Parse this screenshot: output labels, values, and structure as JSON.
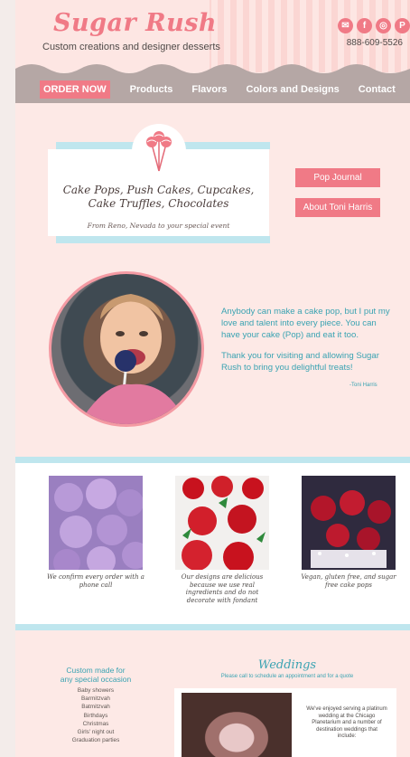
{
  "brand": {
    "name": "Sugar Rush",
    "tagline": "Custom creations and designer desserts",
    "phone": "888-609-5526"
  },
  "social": [
    {
      "icon": "email-icon",
      "glyph": "✉"
    },
    {
      "icon": "facebook-icon",
      "glyph": "f"
    },
    {
      "icon": "instagram-icon",
      "glyph": "◎"
    },
    {
      "icon": "pinterest-icon",
      "glyph": "P"
    }
  ],
  "nav": {
    "order": "ORDER NOW",
    "items": [
      "Products",
      "Flavors",
      "Colors and Designs",
      "Contact"
    ]
  },
  "hero": {
    "title_line1": "Cake Pops, Push Cakes, Cupcakes,",
    "title_line2": "Cake Truffles, Chocolates",
    "subtitle": "From Reno, Nevada to your special event"
  },
  "side_buttons": [
    "Pop Journal",
    "About Toni Harris"
  ],
  "intro": {
    "p1": "Anybody can make a cake pop, but I put my love and talent into every piece. You can have your cake (Pop) and eat it too.",
    "p2": "Thank you for visiting and allowing Sugar Rush to bring you delightful treats!",
    "signature": "-Toni Harris"
  },
  "gallery": [
    {
      "caption": "We confirm every order with a phone call"
    },
    {
      "caption": "Our designs are delicious because we use real ingredients and do not decorate with fondant"
    },
    {
      "caption": "Vegan, gluten free, and sugar free cake pops"
    }
  ],
  "occasions": {
    "title_line1": "Custom made for",
    "title_line2": "any special occasion",
    "items": [
      "Baby showers",
      "Barmitzvah",
      "Batmitzvah",
      "Birthdays",
      "Christmas",
      "Girls' night out",
      "Graduation parties"
    ]
  },
  "weddings": {
    "title": "Weddings",
    "subtitle": "Please call to schedule an appointment and for a quote",
    "text": "We've enjoyed serving a platinum wedding at the Chicago Planetarium and a number of destination weddings that include:"
  },
  "colors": {
    "accent": "#f07a86",
    "teal": "#3aa3b2",
    "nav": "#b5a7a5",
    "band": "#bfe6ee"
  }
}
